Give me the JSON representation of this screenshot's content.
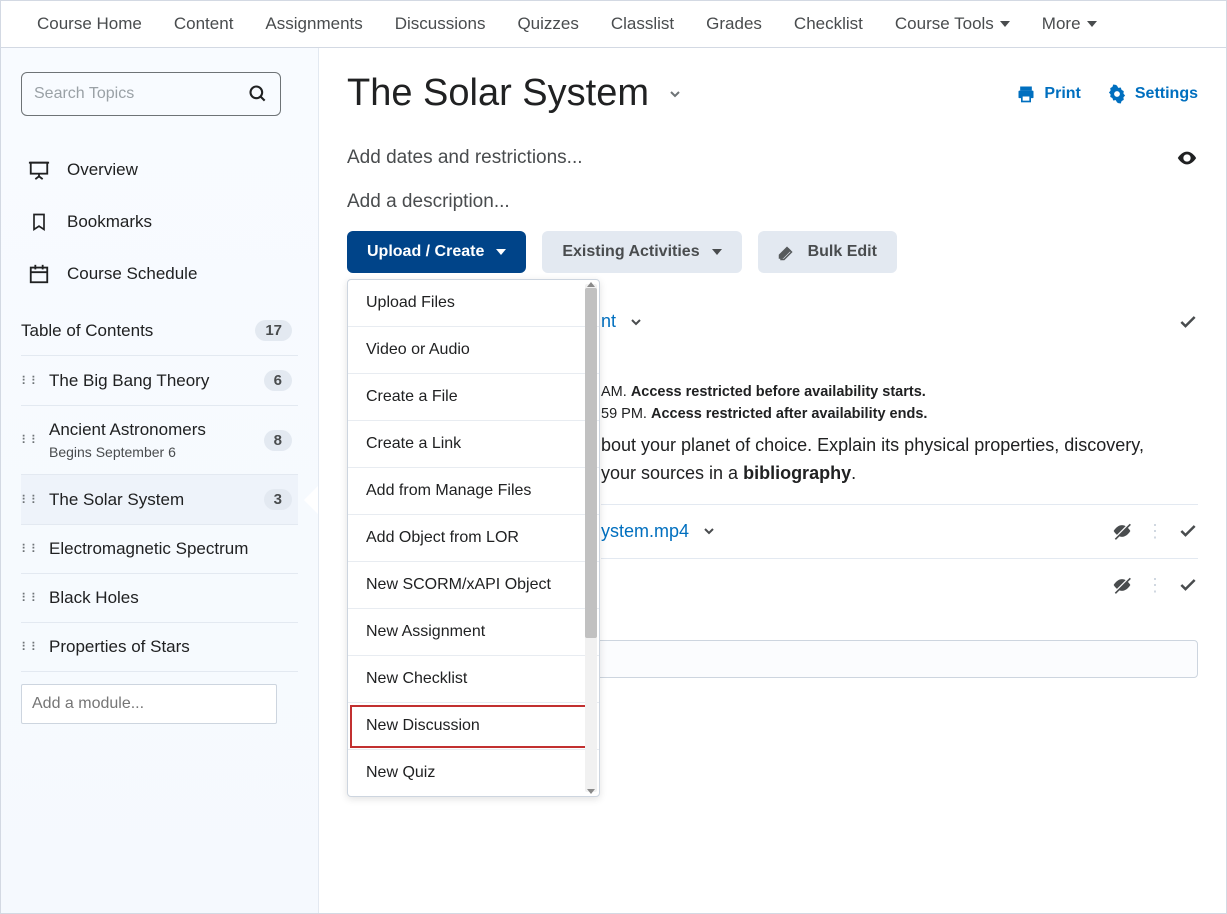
{
  "nav": {
    "items": [
      "Course Home",
      "Content",
      "Assignments",
      "Discussions",
      "Quizzes",
      "Classlist",
      "Grades",
      "Checklist",
      "Course Tools",
      "More"
    ],
    "with_caret": [
      8,
      9
    ]
  },
  "sidebar": {
    "search_placeholder": "Search Topics",
    "overview": "Overview",
    "bookmarks": "Bookmarks",
    "schedule": "Course Schedule",
    "toc_label": "Table of Contents",
    "toc_count": "17",
    "items": [
      {
        "label": "The Big Bang Theory",
        "count": "6"
      },
      {
        "label": "Ancient Astronomers",
        "count": "8",
        "sub": "Begins September 6"
      },
      {
        "label": "The Solar System",
        "count": "3",
        "active": true
      },
      {
        "label": "Electromagnetic Spectrum"
      },
      {
        "label": "Black Holes"
      },
      {
        "label": "Properties of Stars"
      }
    ],
    "add_module_placeholder": "Add a module..."
  },
  "main": {
    "title": "The Solar System",
    "print": "Print",
    "settings": "Settings",
    "add_dates": "Add dates and restrictions...",
    "add_desc": "Add a description...",
    "btn_upload": "Upload / Create",
    "btn_existing": "Existing Activities",
    "btn_bulk": "Bulk Edit",
    "dropdown": [
      "Upload Files",
      "Video or Audio",
      "Create a File",
      "Create a Link",
      "Add from Manage Files",
      "Add Object from LOR",
      "New SCORM/xAPI Object",
      "New Assignment",
      "New Checklist",
      "New Discussion",
      "New Quiz"
    ],
    "dropdown_highlight_index": 9,
    "item1": {
      "link_suffix": "nt",
      "avail_start_suffix": "AM.",
      "avail_start_note": "Access restricted before availability starts.",
      "avail_end_suffix": "59 PM.",
      "avail_end_note": "Access restricted after availability ends.",
      "body_fragment_1": "bout your planet of choice. Explain its physical properties, discovery,",
      "body_fragment_2": "your sources in a ",
      "body_bold": "bibliography",
      "body_end": "."
    },
    "item2": {
      "link_suffix": "ystem.mp4"
    }
  },
  "colors": {
    "primary": "#004489",
    "link": "#006fbf"
  }
}
